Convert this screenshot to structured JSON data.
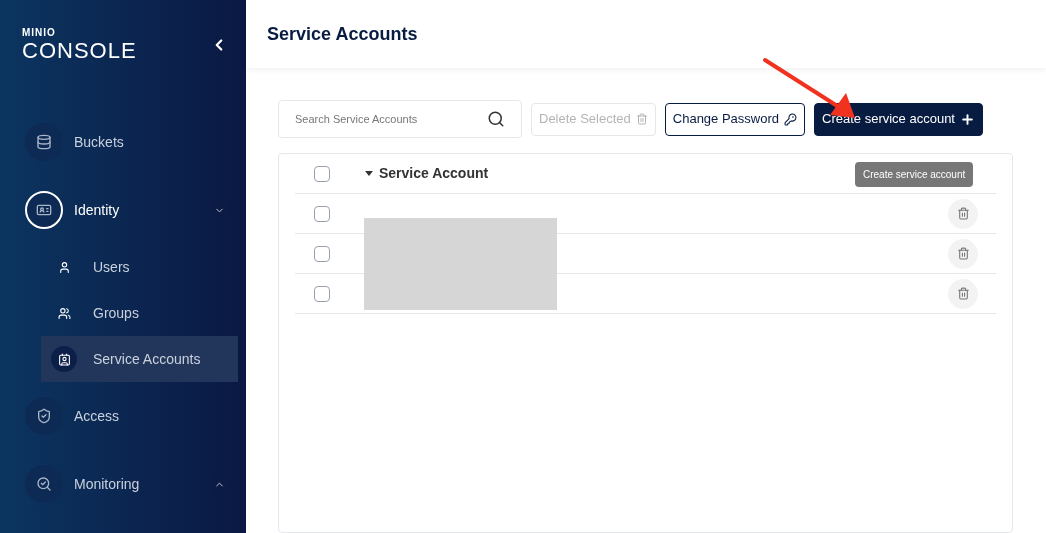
{
  "logo": {
    "top": "MINIO",
    "bottom": "CONSOLE"
  },
  "sidebar": {
    "items": [
      {
        "label": "Buckets",
        "selected": false
      },
      {
        "label": "Identity",
        "selected": true,
        "expanded": true,
        "children": [
          {
            "label": "Users",
            "selected": false
          },
          {
            "label": "Groups",
            "selected": false
          },
          {
            "label": "Service Accounts",
            "selected": true
          }
        ]
      },
      {
        "label": "Access",
        "selected": false
      },
      {
        "label": "Monitoring",
        "selected": false,
        "expanded": false
      }
    ]
  },
  "page_title": "Service Accounts",
  "search": {
    "placeholder": "Search Service Accounts"
  },
  "buttons": [
    {
      "kind": "delete",
      "label": "Delete Selected",
      "disabled": true
    },
    {
      "kind": "password",
      "label": "Change Password",
      "disabled": false
    },
    {
      "kind": "create",
      "label": "Create service account"
    }
  ],
  "tooltip": "Create service account",
  "table": {
    "columns": [
      "Service Account"
    ],
    "all_checked": false,
    "rows": [
      {
        "checked": false
      },
      {
        "checked": false
      },
      {
        "checked": false
      }
    ]
  }
}
